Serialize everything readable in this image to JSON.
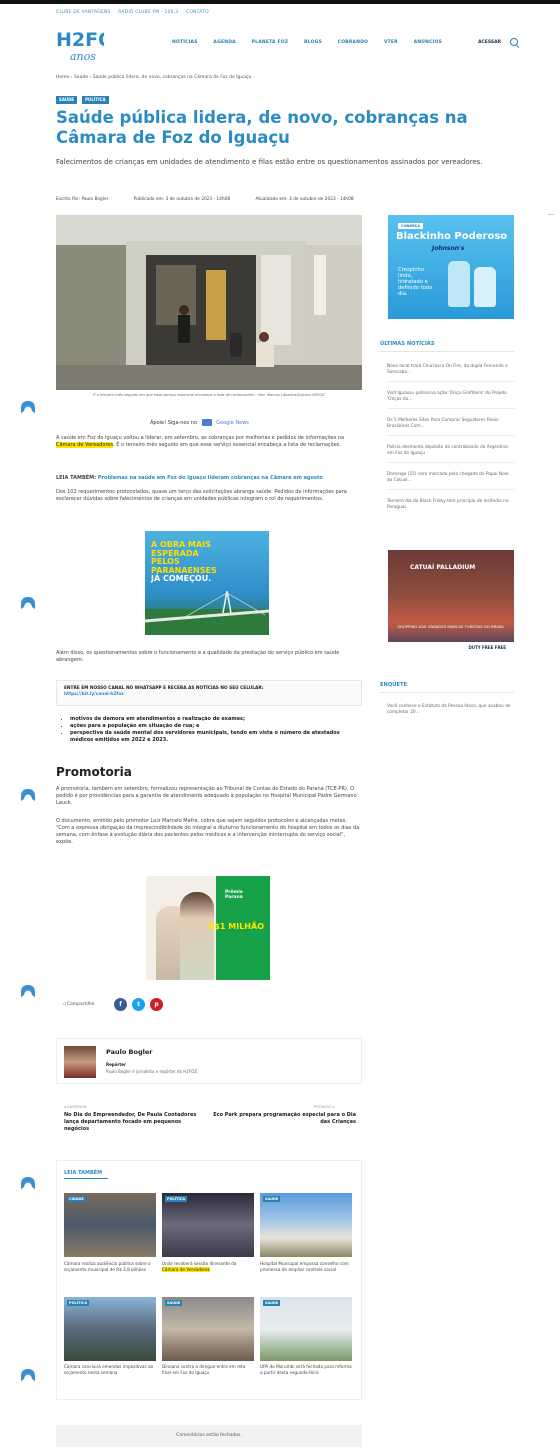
{
  "top_links": [
    "CLUBE DE VANTAGENS",
    "RADIO CLUBE FM - 100,3",
    "CONTATO"
  ],
  "logo": {
    "main": "H2FOZ",
    "sub": "anos"
  },
  "nav": [
    "NOTÍCIAS",
    "AGENDA",
    "PLANETA FOZ",
    "BLOGS",
    "COBRANDO",
    "VTER",
    "ANÚNCIOS"
  ],
  "header": {
    "login": "ACESSAR"
  },
  "breadcrumb": "Home  ›  Saúde  ›  Saúde pública lidera, de novo, cobranças na Câmara de Foz do Iguaçu",
  "tags": [
    "SAÚDE",
    "POLÍTICA"
  ],
  "article": {
    "title": "Saúde pública lidera, de novo, cobranças na Câmara de Foz do Iguaçu",
    "subtitle": "Falecimentos de crianças em unidades de atendimento e filas estão entre os questionamentos assinados por vereadores.",
    "meta": {
      "author": "Escrito Por: Paulo Bogler",
      "published": "Publicado em: 3 de outubro de 2023 - 14h08",
      "updated": "Atualizado em: 3 de outubro de 2023 - 14h08"
    },
    "image_caption": "É o terceiro mês seguido em que esse serviço essencial encabeça a lista de reclamações - foto: Marcos Labanca/Arquivo H2FOZ",
    "gnews": {
      "prefix": "Apoie! Siga-nos no",
      "link": "Google News"
    },
    "p1_a": "A saúde em Foz do Iguaçu voltou a liderar, em setembro, as cobranças por melhorias e pedidos de informações na ",
    "p1_hl": "Câmara de Vereadores",
    "p1_b": ". É o terceiro mês seguido em que esse serviço essencial encabeça a lista de reclamações.",
    "leia_label": "LEIA TAMBÉM:",
    "leia_link": "Problemas na saúde em Foz do Iguaçu lideram cobranças na Câmara em agosto",
    "p2": "Dos 102 requerimentos protocolados, quase um terço das solicitações abrange saúde. Pedidos de informações para esclarecer dúvidas sobre falecimentos de crianças em unidades públicas integram o rol de requerimentos.",
    "p3": "Além disso, os questionamentos sobre o funcionamento e a qualidade da prestação do serviço público em saúde abrangem:",
    "whatsapp_text": "ENTRE EM NOSSO CANAL NO WHATSAPP E RECEBA AS NOTÍCIAS NO SEU CELULAR:",
    "whatsapp_url": "https://bit.ly/canal-h2foz",
    "bullets": [
      "motivos de demora em atendimentos e realização de exames;",
      "ações para a população em situação de rua; e",
      "perspectiva da saúde mental dos servidores municipais, tendo em vista o número de atestados médicos emitidos em 2022 e 2023."
    ],
    "h2": "Promotoria",
    "p4": "A promotoria, também em setembro, formalizou representação ao Tribunal de Contas do Estado do Paraná (TCE-PR). O pedido é por providências para a garantia de atendimento adequado à população no Hospital Municipal Padre Germano Lauck.",
    "p5": "O documento, emitido pelo promotor Luiz Marcelo Mafra, cobra que sejam seguidos protocolos e alcançadas metas. \"Com a expressa obrigação da imprescindibilidade do integral e diuturno funcionamento do hospital em todos os dias da semana, com ênfase à evolução diária dos pacientes pelos médicos e a intervenção ininterrupta do serviço social\", expõe."
  },
  "ads": {
    "mid1_line1": "A OBRA MAIS ESPERADA",
    "mid1_line2": "PELOS PARANAENSES",
    "mid1_line3": "JÁ COMEÇOU.",
    "mid2_a": "Prêmio Paraná",
    "mid2_b": "R$1 MILHÃO",
    "side1_label": "CONHEÇA",
    "side1_title": "Blackinho Poderoso",
    "side1_brand": "Johnson's",
    "side1_text": "Crespinho lindo, hidratado e definido todo dia.",
    "side2_title": "CATUAÍ PALLADIUM",
    "side2_text": "SHOPPING DAS GRANDES MARCAS TURISTAS DO BRASIL",
    "side2_bar": "DUTY FREE FREE"
  },
  "share": {
    "label": "Compartilhe"
  },
  "author": {
    "name": "Paulo Bogler",
    "role": "Repórter",
    "desc": "Paulo Bogler é jornalista e repórter do H2FOZ."
  },
  "post_nav": {
    "prev_label": "◂  ANTERIOR",
    "prev_title": "No Dia do Empreendedor, De Paula Contadores lança departamento focado em pequenos negócios",
    "next_label": "PRÓXIMO  ▸",
    "next_title": "Eco Park prepara programação especial para o Dia das Crianças"
  },
  "related": {
    "heading": "LEIA TAMBÉM",
    "items": [
      {
        "tag": "CIDADE",
        "title": "Câmara realiza audiência pública sobre o orçamento municipal de R$ 2,8 bilhões"
      },
      {
        "tag": "POLÍTICA",
        "title_a": "Unila receberá sessão itinerante da ",
        "title_hl": "Câmara de Vereadores"
      },
      {
        "tag": "SAÚDE",
        "title": "Hospital Municipal empossa conselho com promessa de ampliar controle social"
      },
      {
        "tag": "POLÍTICA",
        "title": "Câmara concluirá emendas impositivas ao orçamento nesta semana"
      },
      {
        "tag": "SAÚDE",
        "title": "Dinoano contra a dengue entra em reta final em Foz do Iguaçu"
      },
      {
        "tag": "SAÚDE",
        "title": "UPA do Morumbi será fechada para reforma a partir desta segunda-feira"
      }
    ]
  },
  "sidebar": {
    "latest_heading": "ÚLTIMAS NOTÍCIAS",
    "latest": [
      "Novo local trará Churrasco On Fire, da dupla Fernando e Sorocaba...",
      "Visit Iguassu patrocina ação 'Onça Grafiteira' do Projeto 'Onças do...",
      "Os 5 Melhores Sites Para Comprar Seguidores Reais Brasileiros Com...",
      "Polícia desmonta depósito de contrabando da Argentina em Foz do Iguaçu",
      "Domingo (15) será marcado pela chegada do Papai Noel ao Catuaí...",
      "Terceiro dia da Black Friday tem princípio de incêndio no Paraguai"
    ],
    "poll_heading": "ENQUETE",
    "poll_text": "Você conhece o Estatuto da Pessoa Idosa, que acabou de completar 20..."
  },
  "comments_closed": "Comentários estão fechados.",
  "colors": {
    "accent": "#2b8cc4",
    "tag": "#2b82b5",
    "highlight": "#ffe600",
    "facebook": "#3b5998",
    "twitter": "#1da1f2",
    "pinterest": "#cb2027"
  }
}
